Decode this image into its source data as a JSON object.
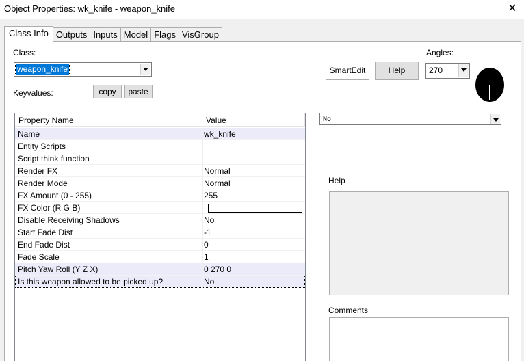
{
  "window": {
    "title": "Object Properties: wk_knife - weapon_knife",
    "close_glyph": "✕"
  },
  "tabs": [
    "Class Info",
    "Outputs",
    "Inputs",
    "Model",
    "Flags",
    "VisGroup"
  ],
  "class_section": {
    "label": "Class:",
    "value": "weapon_knife"
  },
  "buttons": {
    "smartedit": "SmartEdit",
    "help": "Help",
    "copy": "copy",
    "paste": "paste"
  },
  "angles": {
    "label": "Angles:",
    "value": "270"
  },
  "keyvalues_label": "Keyvalues:",
  "grid": {
    "columns": [
      "Property Name",
      "Value"
    ],
    "rows": [
      {
        "name": "Name",
        "value": "wk_knife"
      },
      {
        "name": "Entity Scripts",
        "value": ""
      },
      {
        "name": "Script think function",
        "value": ""
      },
      {
        "name": "Render FX",
        "value": "Normal"
      },
      {
        "name": "Render Mode",
        "value": "Normal"
      },
      {
        "name": "FX Amount (0 - 255)",
        "value": "255"
      },
      {
        "name": "FX Color (R G B)",
        "value": ""
      },
      {
        "name": "Disable Receiving Shadows",
        "value": "No"
      },
      {
        "name": "Start Fade Dist",
        "value": "-1"
      },
      {
        "name": "End Fade Dist",
        "value": "0"
      },
      {
        "name": "Fade Scale",
        "value": "1"
      },
      {
        "name": "Pitch Yaw Roll (Y Z X)",
        "value": "0 270 0"
      },
      {
        "name": "Is this weapon allowed to be picked up?",
        "value": "No"
      }
    ]
  },
  "value_combo": {
    "value": "No"
  },
  "help_label": "Help",
  "comments_label": "Comments"
}
